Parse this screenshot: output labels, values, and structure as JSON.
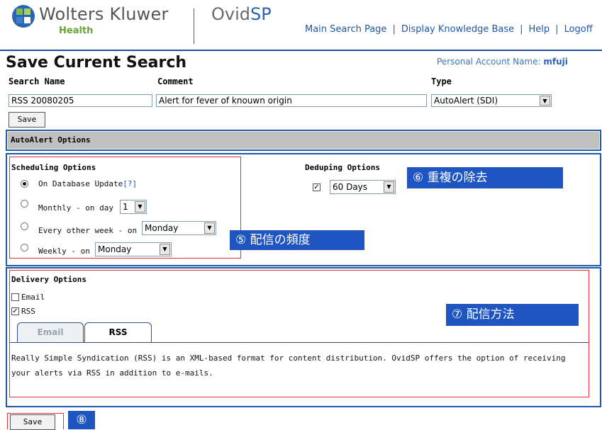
{
  "header": {
    "brand": "Wolters Kluwer",
    "brand_sub": "Health",
    "product_prefix": "Ovid",
    "product_suffix": "SP",
    "nav": [
      "Main Search Page",
      "Display Knowledge Base",
      "Help",
      "Logoff"
    ]
  },
  "page": {
    "title": "Save Current Search",
    "account_label": "Personal Account Name:",
    "account_name": "mfuji"
  },
  "form": {
    "search_name_label": "Search Name",
    "search_name_value": "RSS 20080205",
    "comment_label": "Comment",
    "comment_value": "Alert for fever of knouwn origin",
    "type_label": "Type",
    "type_value": "AutoAlert (SDI)",
    "save_label": "Save"
  },
  "autoalert": {
    "section_title": "AutoAlert Options",
    "scheduling": {
      "title": "Scheduling Options",
      "on_update_label": "On Database Update",
      "help_link": "[?]",
      "monthly_label": "Monthly - on day",
      "monthly_day": "1",
      "biweekly_label": "Every other week - on",
      "biweekly_day": "Monday",
      "weekly_label": "Weekly - on",
      "weekly_day": "Monday",
      "selected": "On Database Update"
    },
    "deduping": {
      "title": "Deduping Options",
      "checked": true,
      "value": "60 Days"
    }
  },
  "delivery": {
    "title": "Delivery Options",
    "email_label": "Email",
    "email_checked": false,
    "rss_label": "RSS",
    "rss_checked": true,
    "tabs": [
      {
        "label": "Email",
        "active": false
      },
      {
        "label": "RSS",
        "active": true
      }
    ],
    "description": "Really Simple Syndication (RSS) is an XML-based format for content distribution. OvidSP offers the option of receiving your alerts via RSS in addition to e-mails."
  },
  "bottom": {
    "save_label": "Save"
  },
  "callouts": {
    "frequency": "⑤ 配信の頻度",
    "dedupe": "⑥ 重複の除去",
    "delivery": "⑦ 配信方法",
    "save": "⑧"
  },
  "colors": {
    "frame_blue": "#1d5aa8",
    "callout_blue": "#1f55c0",
    "highlight_red": "#e0303a",
    "section_gray": "#c0c0c0",
    "health_green": "#6aa33a"
  }
}
